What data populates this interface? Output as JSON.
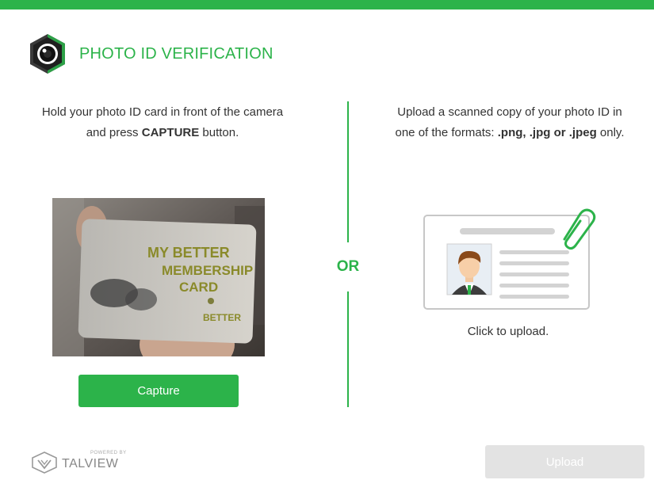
{
  "colors": {
    "brand_green": "#2cb34a",
    "disabled_gray": "#e3e3e3"
  },
  "header": {
    "logo_icon": "camera-lens-icon",
    "title": "PHOTO ID VERIFICATION"
  },
  "capture_section": {
    "instruction_part1": "Hold your photo ID card in front of the camera and press ",
    "instruction_bold": "CAPTURE",
    "instruction_part2": " button.",
    "camera_card_text": {
      "line1": "MY BETTER",
      "line2": "MEMBERSHIP",
      "line3": "CARD",
      "brand": "BETTER"
    },
    "capture_button_label": "Capture"
  },
  "separator_label": "OR",
  "upload_section": {
    "instruction_part1": "Upload a scanned copy of your photo ID in one of the formats: ",
    "instruction_bold": ".png, .jpg or .jpeg",
    "instruction_part2": " only.",
    "card_icon": "id-card-with-paperclip-icon",
    "click_text": "Click to upload."
  },
  "footer": {
    "powered_by": "POWERED BY",
    "brand_name": "TALVIEW",
    "upload_button_label": "Upload"
  }
}
